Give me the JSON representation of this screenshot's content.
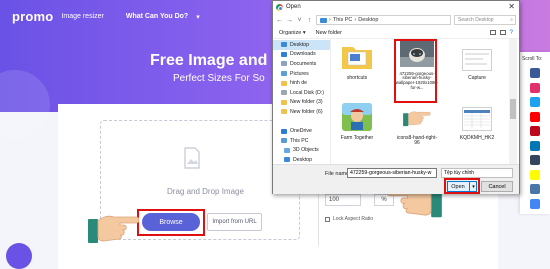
{
  "promo": {
    "logo": "promo",
    "product": "Image resizer",
    "nav_link": "What Can You Do?",
    "hero_title": "Free Image and",
    "hero_subtitle": "Perfect Sizes For So",
    "drop_text": "Drag and Drop Image",
    "browse_label": "Browse",
    "import_label": "Import from URL",
    "percent_value": "100",
    "percent_unit": "%",
    "lock_label": "Lock Aspect Ratio"
  },
  "scroll_panel": {
    "title": "Scroll To:",
    "icons": [
      {
        "name": "facebook-icon",
        "color": "#3b5998"
      },
      {
        "name": "instagram-icon",
        "color": "#e1306c"
      },
      {
        "name": "twitter-icon",
        "color": "#1da1f2"
      },
      {
        "name": "youtube-icon",
        "color": "#ff0000"
      },
      {
        "name": "pinterest-icon",
        "color": "#bd081c"
      },
      {
        "name": "linkedin-icon",
        "color": "#0077b5"
      },
      {
        "name": "tumblr-icon",
        "color": "#35465c"
      },
      {
        "name": "snapchat-icon",
        "color": "#fffc00"
      },
      {
        "name": "vk-icon",
        "color": "#4a76a8"
      },
      {
        "name": "google-icon",
        "color": "#4285f4"
      }
    ]
  },
  "dialog": {
    "title": "Open",
    "breadcrumb": [
      "This PC",
      "Desktop"
    ],
    "search_placeholder": "Search Desktop",
    "organize_label": "Organize ▾",
    "new_folder_label": "New folder",
    "nav_items": [
      {
        "label": "Desktop",
        "icon": "desktop-icon",
        "selected": true
      },
      {
        "label": "Downloads",
        "icon": "downloads-icon"
      },
      {
        "label": "Documents",
        "icon": "documents-icon"
      },
      {
        "label": "Pictures",
        "icon": "pictures-icon"
      },
      {
        "label": "hinh de",
        "icon": "folder-icon"
      },
      {
        "label": "Local Disk (D:)",
        "icon": "drive-icon"
      },
      {
        "label": "New folder (3)",
        "icon": "folder-icon"
      },
      {
        "label": "New folder (6)",
        "icon": "folder-icon"
      },
      {
        "label": "",
        "icon": "spacer"
      },
      {
        "label": "OneDrive",
        "icon": "onedrive-icon"
      },
      {
        "label": "This PC",
        "icon": "pc-icon"
      },
      {
        "label": "3D Objects",
        "icon": "objects-icon"
      },
      {
        "label": "Desktop",
        "icon": "desktop-icon"
      }
    ],
    "files": [
      {
        "label": "shortcuts",
        "kind": "folder"
      },
      {
        "label": "472259-gorgeous-siberian-husky-wallpaper-1920x1080-for-w...",
        "kind": "photo"
      },
      {
        "label": "Capture",
        "kind": "capture"
      },
      {
        "label": "Farm Together",
        "kind": "game"
      },
      {
        "label": "icons8-hand-right-96",
        "kind": "hand"
      },
      {
        "label": "KQDKMH_HK2",
        "kind": "sheet"
      }
    ],
    "filename_label": "File name:",
    "filename_value": "472259-gorgeous-siberian-husky-w",
    "filetype_value": "Tệp tùy chỉnh",
    "open_label": "Open",
    "cancel_label": "Cancel"
  }
}
